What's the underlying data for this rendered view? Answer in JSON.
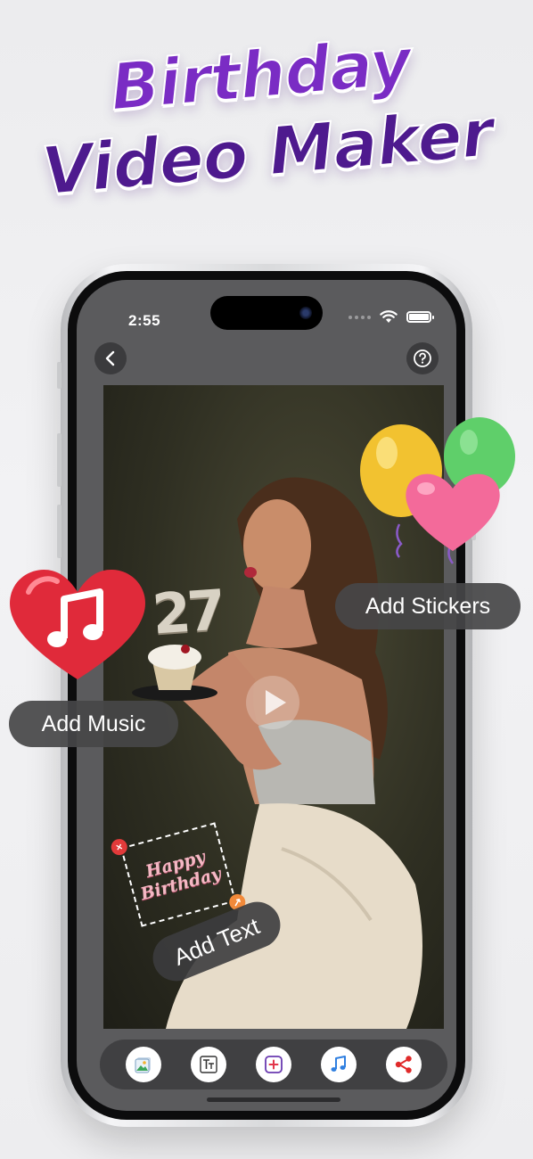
{
  "headline": {
    "line1": "Birthday",
    "line2": "Video Maker"
  },
  "status_bar": {
    "time": "2:55"
  },
  "editor": {
    "cake_number": "27",
    "sticker_text_line1": "Happy",
    "sticker_text_line2": "Birthday"
  },
  "toolbar": {
    "tools": [
      {
        "name": "gallery",
        "icon": "photo-icon"
      },
      {
        "name": "text",
        "icon": "text-icon"
      },
      {
        "name": "add-sticker",
        "icon": "add-icon"
      },
      {
        "name": "music",
        "icon": "music-note-icon"
      },
      {
        "name": "share",
        "icon": "share-icon"
      }
    ]
  },
  "labels": {
    "add_stickers": "Add Stickers",
    "add_music": "Add Music",
    "add_text": "Add Text"
  },
  "colors": {
    "headline_purple": "#6a24b0",
    "screen_bg": "#5b5b5d",
    "accent_red": "#e23a3a"
  }
}
